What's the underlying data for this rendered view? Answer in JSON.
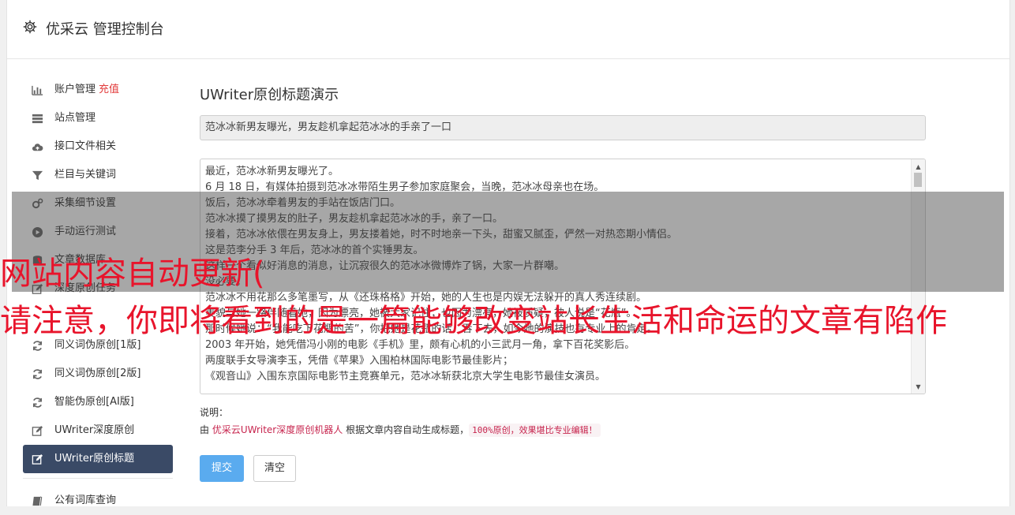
{
  "header": {
    "title": "优采云 管理控制台",
    "icon": "gear-icon"
  },
  "sidebar": {
    "items": [
      {
        "label": "账户管理",
        "badge": "充值",
        "icon": "bar-chart-icon"
      },
      {
        "label": "站点管理",
        "icon": "server-icon"
      },
      {
        "label": "接口文件相关",
        "icon": "cloud-upload-icon"
      },
      {
        "label": "栏目与关键词",
        "icon": "filter-icon"
      },
      {
        "label": "采集细节设置",
        "icon": "cogs-icon"
      },
      {
        "label": "手动运行测试",
        "icon": "play-circle-icon"
      },
      {
        "label": "文章数据库",
        "icon": "database-icon"
      },
      {
        "label": "深度原创任务",
        "icon": "edit-icon"
      },
      {
        "label": "",
        "icon": "blank"
      },
      {
        "label": "同义词伪原创[1版]",
        "icon": "refresh-icon"
      },
      {
        "label": "同义词伪原创[2版]",
        "icon": "refresh-icon"
      },
      {
        "label": "智能伪原创[AI版]",
        "icon": "refresh-icon"
      },
      {
        "label": "UWriter深度原创",
        "icon": "edit-icon"
      },
      {
        "label": "UWriter原创标题",
        "icon": "edit-icon",
        "active": true
      }
    ],
    "bottom_item": {
      "label": "公有词库查询",
      "icon": "book-icon"
    }
  },
  "main": {
    "heading": "UWriter原创标题演示",
    "title_value": "范冰冰新男友曝光，男友趁机拿起范冰冰的手亲了一口",
    "body_lines": [
      "最近，范冰冰新男友曝光了。",
      "6 月 18 日，有媒体拍摄到范冰冰带陌生男子参加家庭聚会，当晚，范冰冰母亲也在场。",
      "饭后，范冰冰牵着男友的手站在饭店门口。",
      "范冰冰摸了摸男友的肚子，男友趁机拿起范冰冰的手，亲了一口。",
      "接着，范冰冰依偎在男友身上，男友搂着她，时不时地亲一下头，甜蜜又腻歪，俨然一对热恋期小情侣。",
      "这是范李分手 3 年后，范冰冰的首个实锤男友。",
      "这样一个看似好消息的消息，让沉寂很久的范冰冰微博炸了锅，大家一片群嘲。",
      "没必要。",
      "范冰冰不用花那么多笔墨写，从《还珠格格》开始，她的人生也是内娱无法躲开的真人秀连续剧。",
      "美貌与她一路伴随着她，因为漂亮，她被大家记住；也因为漂亮，她被质疑，被人说是“花瓶”。",
      "那时候她说：“我能吃下花瓶的苦”，你把她是花瓶的话，吞下去，如今她的演技也有专业上的肯定。",
      "2003 年开始，她凭借冯小刚的电影《手机》里，颇有心机的小三武月一角，拿下百花奖影后。",
      "两度联手女导演李玉，凭借《苹果》入围柏林国际电影节最佳影片；",
      "《观音山》入围东京国际电影节主竞赛单元，范冰冰斩获北京大学生电影节最佳女演员。"
    ],
    "note_label": "说明：",
    "note_prefix": "由",
    "note_brand": "优采云UWriter深度原创机器人",
    "note_middle": "根据文章内容自动生成标题，",
    "note_tag": "100%原创，效果堪比专业编辑！",
    "submit_label": "提交",
    "clear_label": "清空"
  },
  "overlay": {
    "line1": "网站内容自动更新(",
    "line2": "请注意，你即将看到的是一篇能够改变站长生活和命运的文章有陷作"
  },
  "colors": {
    "active_bg": "#3a4a66",
    "primary": "#5aabef",
    "warn": "#e8142b",
    "brand": "#c7254e"
  }
}
